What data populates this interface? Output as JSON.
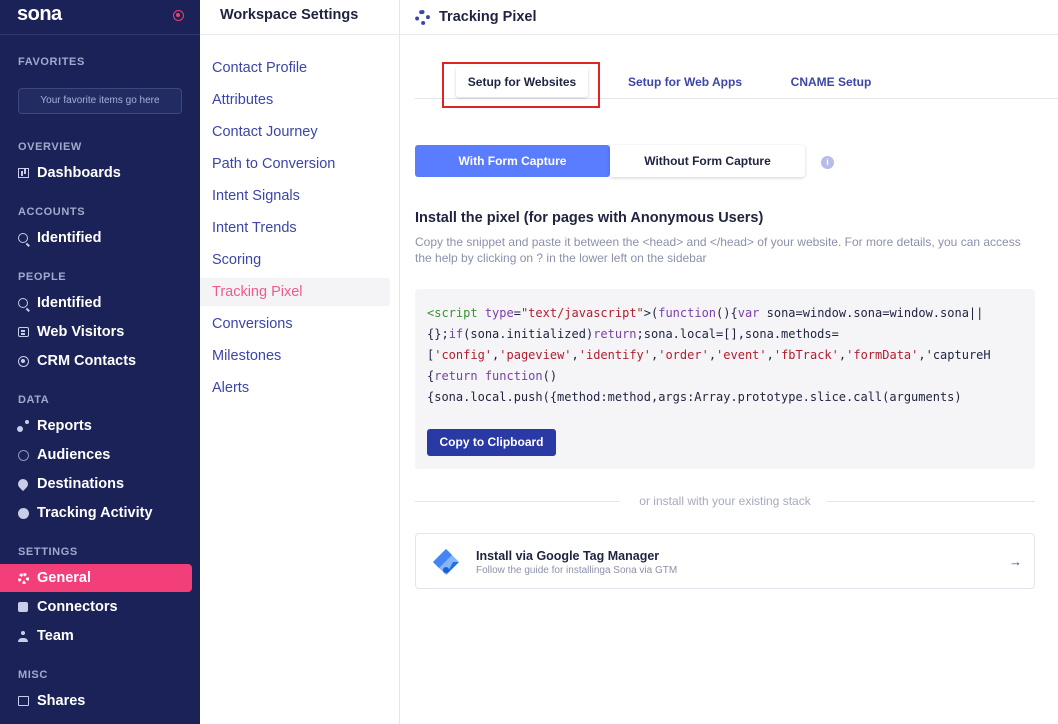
{
  "brand": {
    "name": "sona"
  },
  "nav": {
    "favorites_header": "FAVORITES",
    "favorites_placeholder": "Your favorite items go here",
    "sections": {
      "overview": "OVERVIEW",
      "accounts": "ACCOUNTS",
      "people": "PEOPLE",
      "data": "DATA",
      "settings": "SETTINGS",
      "misc": "MISC"
    },
    "items": {
      "dashboards": {
        "label": "Dashboards",
        "icon": "bar-chart-icon"
      },
      "accounts_identified": {
        "label": "Identified",
        "icon": "search-icon"
      },
      "people_identified": {
        "label": "Identified",
        "icon": "search-icon"
      },
      "web_visitors": {
        "label": "Web Visitors",
        "icon": "document-icon"
      },
      "crm_contacts": {
        "label": "CRM Contacts",
        "icon": "globe-icon"
      },
      "reports": {
        "label": "Reports",
        "icon": "dots-icon"
      },
      "audiences": {
        "label": "Audiences",
        "icon": "face-icon"
      },
      "destinations": {
        "label": "Destinations",
        "icon": "pin-icon"
      },
      "tracking_activity": {
        "label": "Tracking Activity",
        "icon": "compass-icon"
      },
      "general": {
        "label": "General",
        "icon": "gear-icon"
      },
      "connectors": {
        "label": "Connectors",
        "icon": "puzzle-icon"
      },
      "team": {
        "label": "Team",
        "icon": "person-icon"
      },
      "shares": {
        "label": "Shares",
        "icon": "share-icon"
      }
    },
    "active_item": "general",
    "colors": {
      "background": "#1b2257",
      "active": "#f23f7a"
    }
  },
  "submenu": {
    "title": "Workspace Settings",
    "items": [
      "Contact Profile",
      "Attributes",
      "Contact Journey",
      "Path to Conversion",
      "Intent Signals",
      "Intent Trends",
      "Scoring",
      "Tracking Pixel",
      "Conversions",
      "Milestones",
      "Alerts"
    ],
    "active_item": "Tracking Pixel"
  },
  "page": {
    "title": "Tracking Pixel",
    "tabs": [
      "Setup for Websites",
      "Setup for Web Apps",
      "CNAME Setup"
    ],
    "active_tab": "Setup for Websites",
    "capture_options": [
      "With Form Capture",
      "Without Form Capture"
    ],
    "active_capture_option": "With Form Capture",
    "info_icon": "i",
    "install_title": "Install the pixel (for pages with Anonymous Users)",
    "install_description": "Copy the snippet and paste it between the <head> and </head> of your website. For more details, you can access the help by clicking on ? in the lower left on the sidebar",
    "code_lines": [
      "<script type=\"text/javascript\">(function(){var sona=window.sona=window.sona||",
      "{};if(sona.initialized)return;sona.local=[],sona.methods=",
      "['config','pageview','identify','order','event','fbTrack','formData','captureH",
      "{return function()",
      "{sona.local.push({method:method,args:Array.prototype.slice.call(arguments)"
    ],
    "copy_button": "Copy to Clipboard",
    "or_divider": "or install with your existing stack",
    "gtm": {
      "title": "Install via Google Tag Manager",
      "subtitle": "Follow the guide for installinga Sona via GTM",
      "icon": "gtm-logo-icon",
      "arrow": "→"
    },
    "colors": {
      "primary": "#5a7cff",
      "button": "#2a3aa5",
      "highlight_box": "#e02424"
    }
  }
}
